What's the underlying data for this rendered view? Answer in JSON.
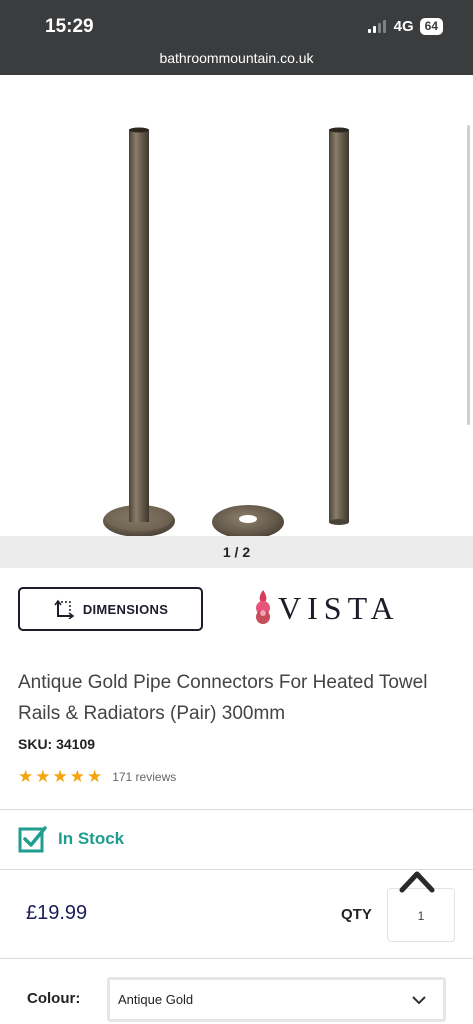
{
  "status_bar": {
    "time": "15:29",
    "network": "4G",
    "battery": "64",
    "url": "bathroommountain.co.uk"
  },
  "gallery": {
    "pager": "1 / 2"
  },
  "actions": {
    "dimensions_label": "DIMENSIONS",
    "brand_name": "VISTA"
  },
  "product": {
    "title": "Antique Gold Pipe Connectors For Heated Towel Rails & Radiators (Pair) 300mm",
    "sku": "SKU: 34109",
    "stars": "★★★★★",
    "reviews": "171 reviews",
    "rating_value": 5,
    "stock": "In Stock",
    "price": "£19.99"
  },
  "purchase": {
    "qty_label": "QTY",
    "qty_value": "1",
    "colour_label": "Colour:",
    "colour_value": "Antique Gold"
  },
  "colors": {
    "status_bar": "#3a3c3e",
    "accent_teal": "#1f9e8f",
    "star": "#f5a30f",
    "price": "#1c1c5a"
  }
}
